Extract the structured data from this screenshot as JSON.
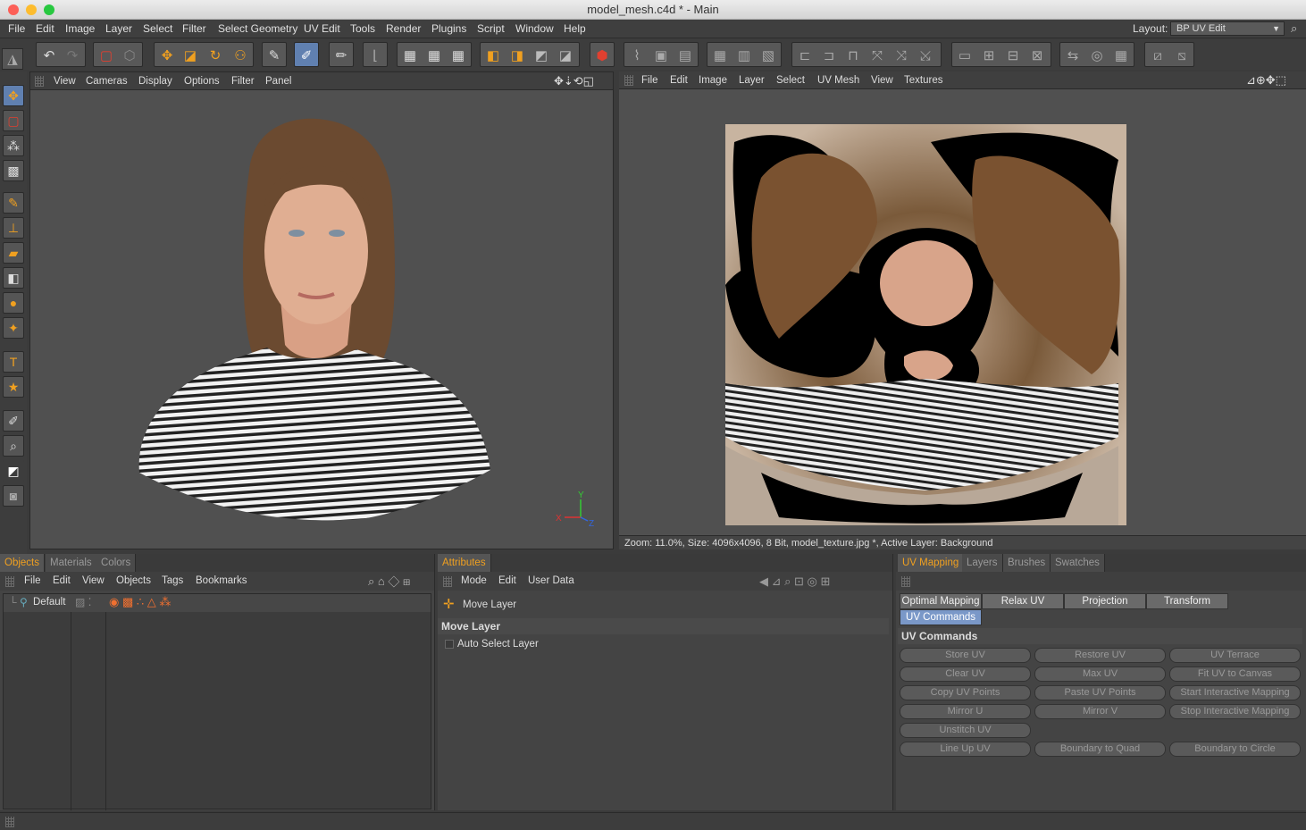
{
  "window": {
    "title": "model_mesh.c4d * - Main"
  },
  "menu": [
    "File",
    "Edit",
    "Image",
    "Layer",
    "Select",
    "Filter",
    "Select Geometry",
    "UV Edit",
    "Tools",
    "Render",
    "Plugins",
    "Script",
    "Window",
    "Help"
  ],
  "layout": {
    "label": "Layout:",
    "value": "BP UV Edit"
  },
  "viewport3d": {
    "menu": [
      "View",
      "Cameras",
      "Display",
      "Options",
      "Filter",
      "Panel"
    ],
    "axes": {
      "x": "X",
      "y": "Y",
      "z": "Z"
    }
  },
  "uvview": {
    "menu": [
      "File",
      "Edit",
      "Image",
      "Layer",
      "Select",
      "UV Mesh",
      "View",
      "Textures"
    ],
    "status": "Zoom: 11.0%, Size: 4096x4096, 8 Bit, model_texture.jpg *, Active Layer: Background"
  },
  "objects": {
    "tabs": [
      "Objects",
      "Materials",
      "Colors"
    ],
    "menu": [
      "File",
      "Edit",
      "View",
      "Objects",
      "Tags",
      "Bookmarks"
    ],
    "row": "Default"
  },
  "attributes": {
    "tab": "Attributes",
    "menu": [
      "Mode",
      "Edit",
      "User Data"
    ],
    "tool": "Move Layer",
    "section": "Move Layer",
    "option": "Auto Select Layer"
  },
  "uvmapping": {
    "tabs": [
      "UV Mapping",
      "Layers",
      "Brushes",
      "Swatches"
    ],
    "subtabs": [
      "Optimal Mapping",
      "Relax UV",
      "Projection",
      "Transform",
      "UV Commands"
    ],
    "section": "UV Commands",
    "buttons": [
      [
        "Store UV",
        "Restore UV",
        "UV Terrace"
      ],
      [
        "Clear UV",
        "Max UV",
        "Fit UV to Canvas"
      ],
      [
        "Copy UV Points",
        "Paste UV Points",
        "Start Interactive Mapping"
      ],
      [
        "Mirror U",
        "Mirror V",
        "Stop Interactive Mapping"
      ],
      [
        "Unstitch UV",
        "",
        ""
      ],
      [
        "Line Up UV",
        "Boundary to Quad",
        "Boundary to Circle"
      ]
    ]
  }
}
